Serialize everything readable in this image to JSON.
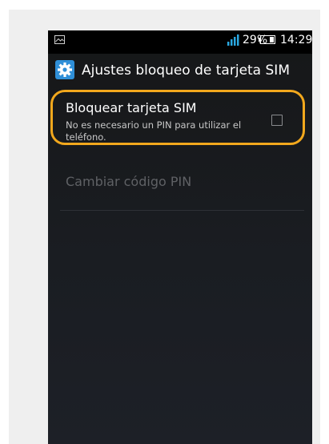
{
  "statusbar": {
    "notification_icon": "image-icon",
    "signal_icon": "signal-bars-icon",
    "battery_percent": "29%",
    "battery_icon": "battery-icon",
    "time": "14:29"
  },
  "actionbar": {
    "icon": "gear-icon",
    "title": "Ajustes bloqueo de tarjeta SIM"
  },
  "settings": {
    "lock_sim": {
      "title": "Bloquear tarjeta SIM",
      "summary": "No es necesario un PIN para utilizar el teléfono.",
      "checked": false
    },
    "change_pin": {
      "title": "Cambiar código PIN",
      "enabled": false
    }
  },
  "colors": {
    "highlight": "#f2a81d",
    "disabled_text": "#5f6165",
    "signal": "#2aa7e0",
    "gear": "#2f8fd8"
  }
}
